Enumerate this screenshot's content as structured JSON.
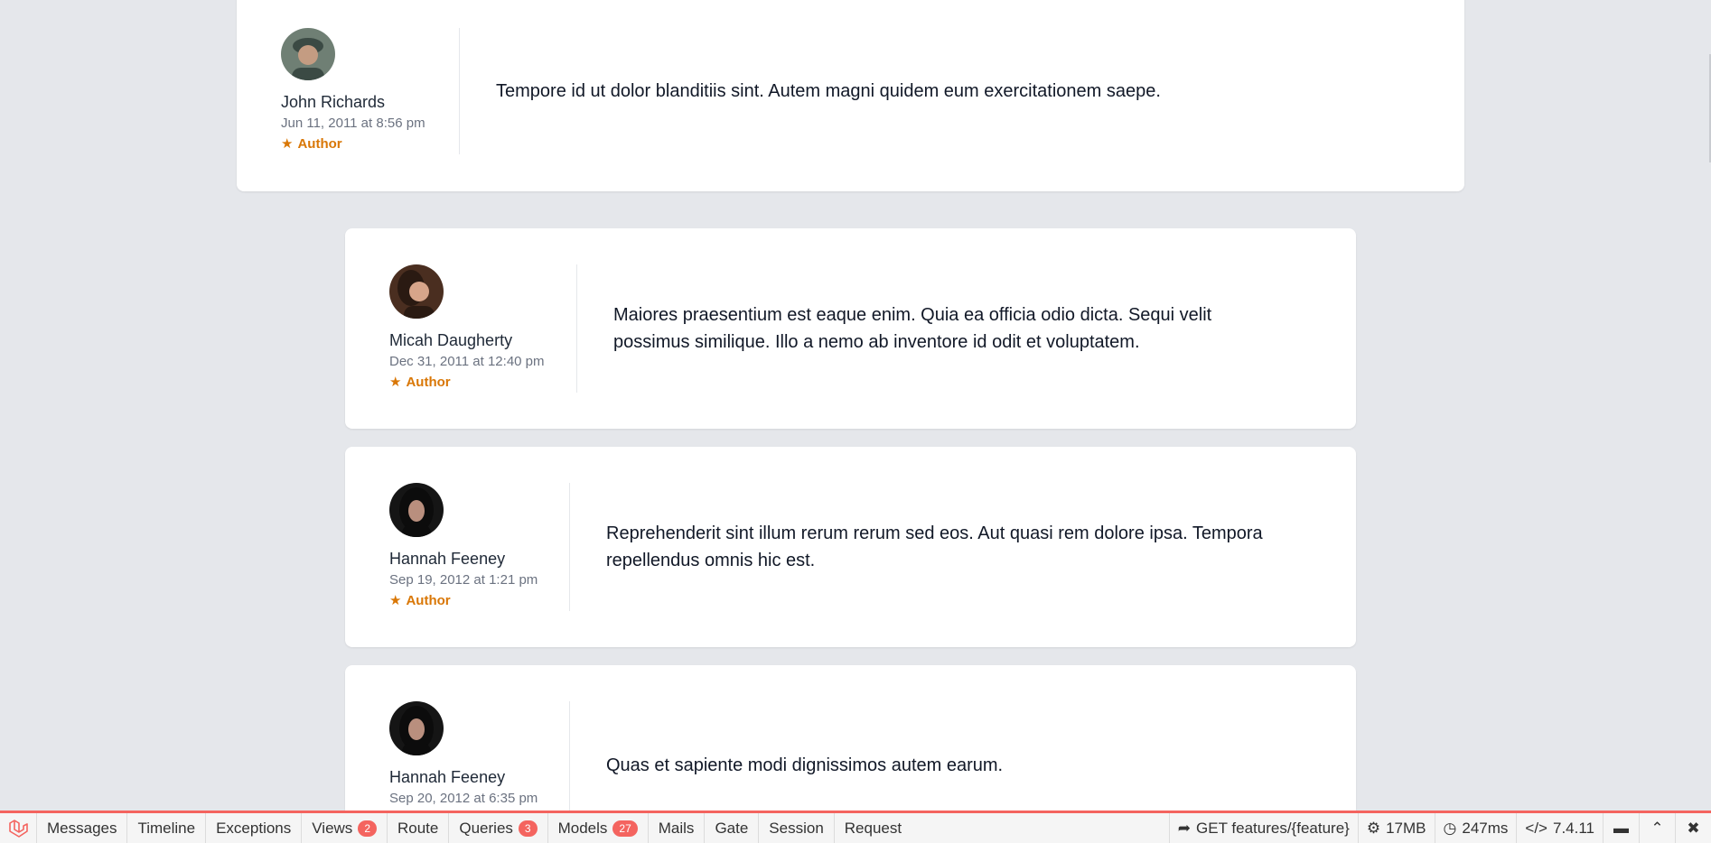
{
  "comments": [
    {
      "author": "John Richards",
      "date": "Jun 11, 2011 at 8:56 pm",
      "badge": "Author",
      "body": "Tempore id ut dolor blanditiis sint. Autem magni quidem eum exercitationem saepe.",
      "avatar_colors": [
        "#6f7f74",
        "#c49c82",
        "#3b4a44"
      ]
    },
    {
      "author": "Micah Daugherty",
      "date": "Dec 31, 2011 at 12:40 pm",
      "badge": "Author",
      "body": "Maiores praesentium est eaque enim. Quia ea officia odio dicta. Sequi velit possimus similique. Illo a nemo ab inventore id odit et voluptatem.",
      "avatar_colors": [
        "#4a2e20",
        "#d7a58a",
        "#2a1a12"
      ]
    },
    {
      "author": "Hannah Feeney",
      "date": "Sep 19, 2012 at 1:21 pm",
      "badge": "Author",
      "body": "Reprehenderit sint illum rerum rerum sed eos. Aut quasi rem dolore ipsa. Tempora repellendus omnis hic est.",
      "avatar_colors": [
        "#151515",
        "#b98f7e",
        "#0c0c0c"
      ]
    },
    {
      "author": "Hannah Feeney",
      "date": "Sep 20, 2012 at 6:35 pm",
      "badge": "",
      "body": "Quas et sapiente modi dignissimos autem earum.",
      "avatar_colors": [
        "#151515",
        "#b98f7e",
        "#0c0c0c"
      ]
    }
  ],
  "debugbar": {
    "tabs": [
      {
        "label": "Messages",
        "badge": ""
      },
      {
        "label": "Timeline",
        "badge": ""
      },
      {
        "label": "Exceptions",
        "badge": ""
      },
      {
        "label": "Views",
        "badge": "2"
      },
      {
        "label": "Route",
        "badge": ""
      },
      {
        "label": "Queries",
        "badge": "3"
      },
      {
        "label": "Models",
        "badge": "27"
      },
      {
        "label": "Mails",
        "badge": ""
      },
      {
        "label": "Gate",
        "badge": ""
      },
      {
        "label": "Session",
        "badge": ""
      },
      {
        "label": "Request",
        "badge": ""
      }
    ],
    "route": "GET features/{feature}",
    "memory": "17MB",
    "time": "247ms",
    "php_version": "7.4.11",
    "accent_color": "#f4645f"
  },
  "colors": {
    "background": "#e5e7eb",
    "card": "#ffffff",
    "badge": "#d97706"
  }
}
